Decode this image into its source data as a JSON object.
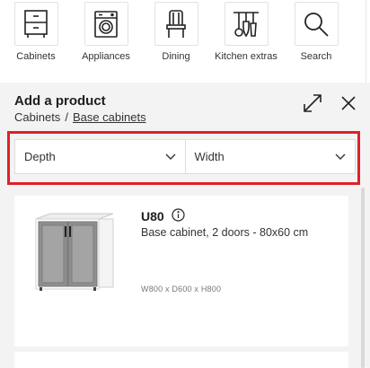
{
  "categories": [
    {
      "label": "Cabinets",
      "icon": "cabinet-icon"
    },
    {
      "label": "Appliances",
      "icon": "washing-machine-icon"
    },
    {
      "label": "Dining",
      "icon": "chair-icon"
    },
    {
      "label": "Kitchen extras",
      "icon": "utensils-icon"
    },
    {
      "label": "Search",
      "icon": "search-icon"
    }
  ],
  "panel": {
    "title": "Add a product",
    "breadcrumb": {
      "parent": "Cabinets",
      "separator": "/",
      "current": "Base cabinets"
    },
    "expand_icon": "expand-icon",
    "close_icon": "close-icon"
  },
  "filters": [
    {
      "label": "Depth",
      "icon": "chevron-down-icon"
    },
    {
      "label": "Width",
      "icon": "chevron-down-icon"
    }
  ],
  "highlight_color": "#e0202a",
  "products": [
    {
      "name": "U80",
      "info_icon": "info-icon",
      "description": "Base cabinet, 2 doors - 80x60 cm",
      "dimensions": "W800 x D600 x H800",
      "image": "grey-base-cabinet-image"
    }
  ]
}
